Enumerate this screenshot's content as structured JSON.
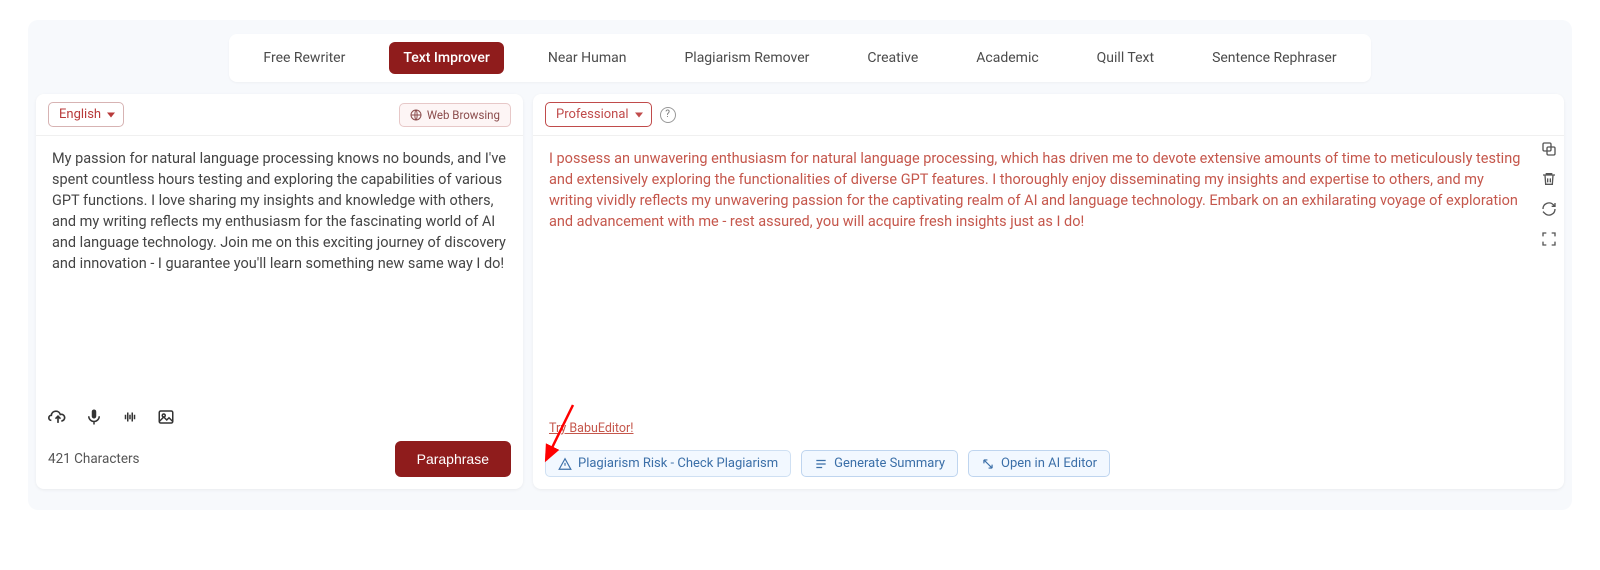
{
  "tabs": {
    "items": [
      {
        "label": "Free Rewriter"
      },
      {
        "label": "Text Improver"
      },
      {
        "label": "Near Human"
      },
      {
        "label": "Plagiarism Remover"
      },
      {
        "label": "Creative"
      },
      {
        "label": "Academic"
      },
      {
        "label": "Quill Text"
      },
      {
        "label": "Sentence Rephraser"
      }
    ],
    "active": 1
  },
  "left": {
    "lang": "English",
    "web_browsing": "Web Browsing",
    "text": "My passion for natural language processing knows no bounds, and I've spent countless hours testing and exploring the capabilities of various GPT functions. I love sharing my insights and knowledge with others, and my writing reflects my enthusiasm for the fascinating world of AI and language technology. Join me on this exciting journey of discovery and innovation - I guarantee you'll learn something new same way I do!",
    "char_count": "421 Characters",
    "paraphrase_button": "Paraphrase"
  },
  "right": {
    "style": "Professional",
    "text": "I possess an unwavering enthusiasm for natural language processing, which has driven me to devote extensive amounts of time to meticulously testing and extensively exploring the functionalities of diverse GPT features. I thoroughly enjoy disseminating my insights and expertise to others, and my writing vividly reflects my unwavering passion for the captivating realm of AI and language technology. Embark on an exhilarating voyage of exploration and advancement with me - rest assured, you will acquire fresh insights just as I do!",
    "try_link": "Try BabuEditor!",
    "chips": {
      "plagiarism": "Plagiarism Risk - Check Plagiarism",
      "summary": "Generate Summary",
      "aieditor": "Open in AI Editor"
    }
  }
}
